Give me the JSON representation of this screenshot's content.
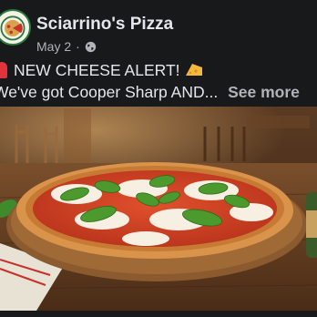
{
  "page": {
    "name": "Sciarrino's Pizza",
    "date": "May 2",
    "separator": "·",
    "audience_icon": "globe-icon"
  },
  "post": {
    "line1": "NEW CHEESE ALERT!",
    "line2": "We've got Cooper Sharp AND...",
    "see_more": "See more",
    "icons": [
      "siren-icon",
      "cheese-icon"
    ]
  },
  "image": {
    "subject": "pizza-photo"
  },
  "colors": {
    "background": "#18191a",
    "text": "#e4e6eb",
    "muted": "#b0b3b8",
    "brand_green": "#2b7a3d",
    "brand_red": "#c8302c"
  }
}
